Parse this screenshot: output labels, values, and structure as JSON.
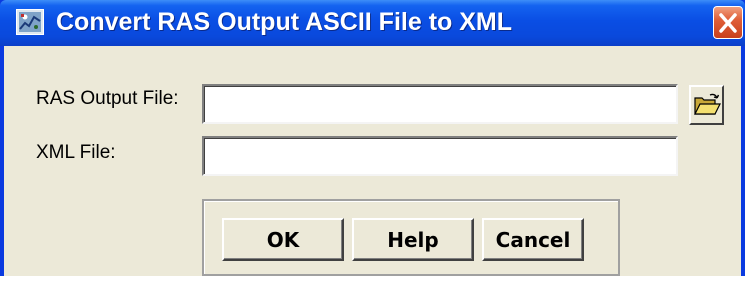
{
  "window": {
    "title": "Convert RAS Output ASCII File to XML",
    "app_icon": "ras-converter-icon",
    "close_icon": "close-icon"
  },
  "form": {
    "ras_output_label": "RAS Output File:",
    "ras_output_value": "",
    "xml_label": "XML File:",
    "xml_value": "",
    "browse_icon": "open-folder-icon"
  },
  "buttons": {
    "ok": "OK",
    "help": "Help",
    "cancel": "Cancel"
  },
  "colors": {
    "titlebar": "#0a4ee4",
    "client_bg": "#ece9d8",
    "close_button": "#d9532a"
  }
}
